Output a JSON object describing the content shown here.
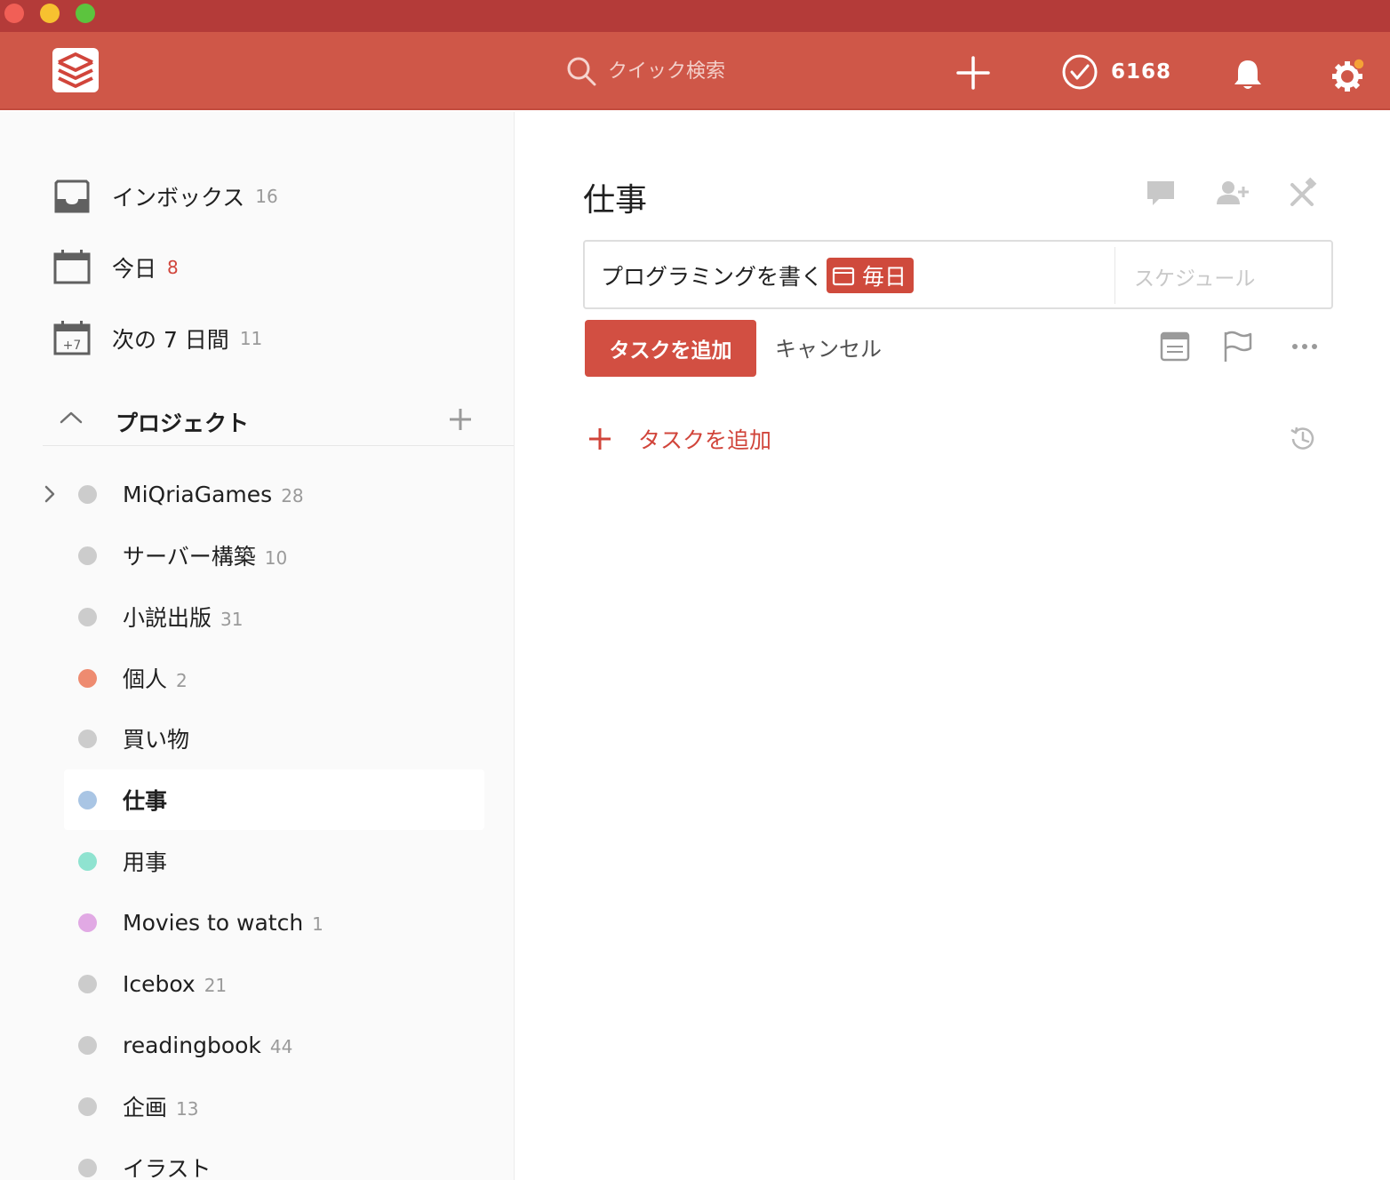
{
  "header": {
    "search_placeholder": "クイック検索",
    "karma_count": "6168",
    "colors": {
      "titlebar": "#b43b39",
      "topbar": "#cf5748",
      "accent": "#d1453b"
    },
    "icons": [
      "todoist-logo-icon",
      "search-icon",
      "plus-icon",
      "karma-check-icon",
      "bell-icon",
      "gear-icon"
    ]
  },
  "sidebar": {
    "nav": [
      {
        "label": "インボックス",
        "count": "16",
        "icon": "inbox-icon"
      },
      {
        "label": "今日",
        "count": "8",
        "icon": "calendar-today-icon"
      },
      {
        "label": "次の 7 日間",
        "count": "11",
        "icon": "calendar-week-icon"
      }
    ],
    "projects_title": "プロジェクト",
    "projects": [
      {
        "name": "MiQriaGames",
        "count": "28",
        "color": "#cccccc"
      },
      {
        "name": "サーバー構築",
        "count": "10",
        "color": "#cccccc"
      },
      {
        "name": "小説出版",
        "count": "31",
        "color": "#cccccc"
      },
      {
        "name": "個人",
        "count": "2",
        "color": "#ee8b70"
      },
      {
        "name": "買い物",
        "count": "",
        "color": "#cccccc"
      },
      {
        "name": "仕事",
        "count": "",
        "color": "#a9c5e4"
      },
      {
        "name": "用事",
        "count": "",
        "color": "#8fe3d0"
      },
      {
        "name": "Movies to watch",
        "count": "1",
        "color": "#e1a9e4"
      },
      {
        "name": "Icebox",
        "count": "21",
        "color": "#cccccc"
      },
      {
        "name": "readingbook",
        "count": "44",
        "color": "#cccccc"
      },
      {
        "name": "企画",
        "count": "13",
        "color": "#cccccc"
      },
      {
        "name": "イラスト",
        "count": "",
        "color": "#cccccc"
      }
    ],
    "active_project": "仕事"
  },
  "main": {
    "title": "仕事",
    "editor": {
      "task_text": "プログラミングを書く",
      "date_tag": "毎日",
      "schedule_placeholder": "スケジュール"
    },
    "add_button": "タスクを追加",
    "cancel_button": "キャンセル",
    "add_task_label": "タスクを追加"
  }
}
